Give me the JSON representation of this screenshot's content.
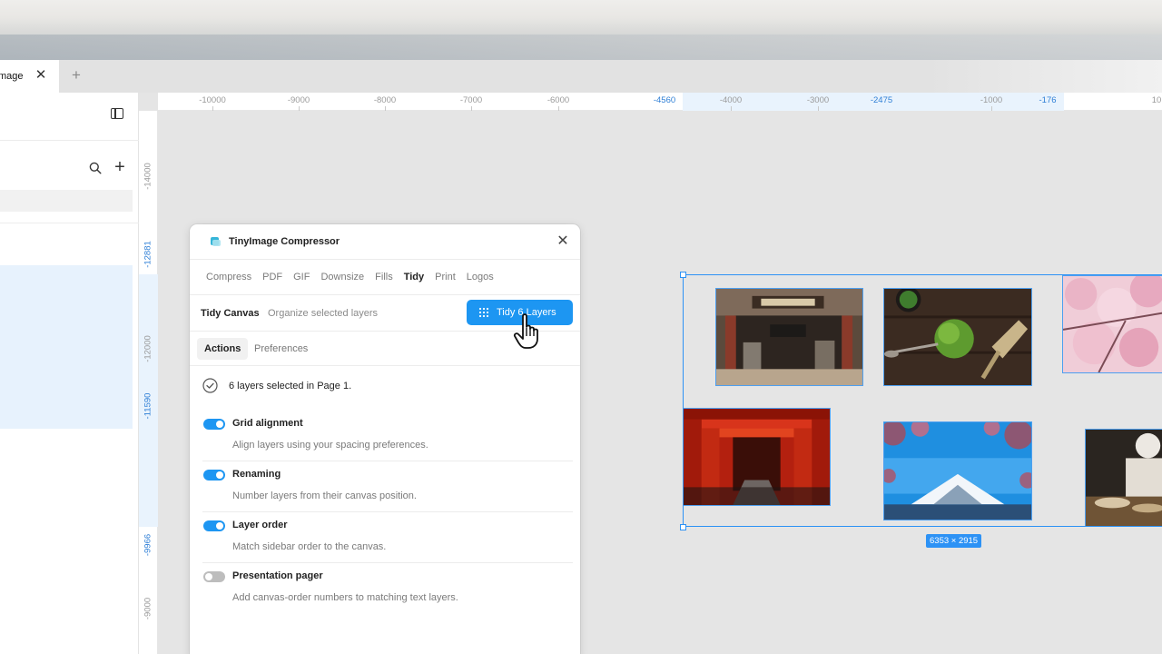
{
  "tabbar": {
    "tab_title": "mage",
    "close_glyph": "✕",
    "add_glyph": "+"
  },
  "sidebar": {
    "add_glyph": "+",
    "icons": [
      "panel-toggle-icon",
      "search-icon",
      "add-icon"
    ]
  },
  "rulers": {
    "top_labels": [
      "-10000",
      "-9000",
      "-8000",
      "-7000",
      "-6000",
      "-4560",
      "-4000",
      "-3000",
      "-2475",
      "-1000",
      "-176",
      "10"
    ],
    "top_selected": [
      "-4560",
      "-2475",
      "-176"
    ],
    "left_labels": [
      "-14000",
      "-12881",
      "-12000",
      "-11590",
      "-9966",
      "-9000"
    ],
    "left_selected": [
      "-12881",
      "-11590",
      "-9966"
    ]
  },
  "plugin": {
    "title": "TinyImage Compressor",
    "close_glyph": "✕",
    "tabs": [
      {
        "label": "Compress",
        "active": false
      },
      {
        "label": "PDF",
        "active": false
      },
      {
        "label": "GIF",
        "active": false
      },
      {
        "label": "Downsize",
        "active": false
      },
      {
        "label": "Fills",
        "active": false
      },
      {
        "label": "Tidy",
        "active": true
      },
      {
        "label": "Print",
        "active": false
      },
      {
        "label": "Logos",
        "active": false
      }
    ],
    "toolbar": {
      "title": "Tidy Canvas",
      "description": "Organize selected layers",
      "run_button": "Tidy 6 Layers"
    },
    "subtabs": [
      {
        "label": "Actions",
        "active": true
      },
      {
        "label": "Preferences",
        "active": false
      }
    ],
    "status": "6 layers selected in Page 1.",
    "options": [
      {
        "title": "Grid alignment",
        "description": "Align layers using your spacing preferences.",
        "enabled": true
      },
      {
        "title": "Renaming",
        "description": "Number layers from their canvas position.",
        "enabled": true
      },
      {
        "title": "Layer order",
        "description": "Match sidebar order to the canvas.",
        "enabled": true
      },
      {
        "title": "Presentation pager",
        "description": "Add canvas-order numbers to matching text layers.",
        "enabled": false
      }
    ]
  },
  "canvas": {
    "selection_size": "6353 × 2915",
    "photos": [
      "japanese-storefront",
      "matcha-tea-set",
      "cherry-blossoms",
      "torii-gates-tunnel",
      "mount-fuji-blossoms",
      "sushi-chef"
    ]
  },
  "colors": {
    "accent": "#1d96f2",
    "selection": "#2d92f5",
    "sidebar_selected": "#e7f2fd",
    "canvas_bg": "#e5e5e5"
  }
}
